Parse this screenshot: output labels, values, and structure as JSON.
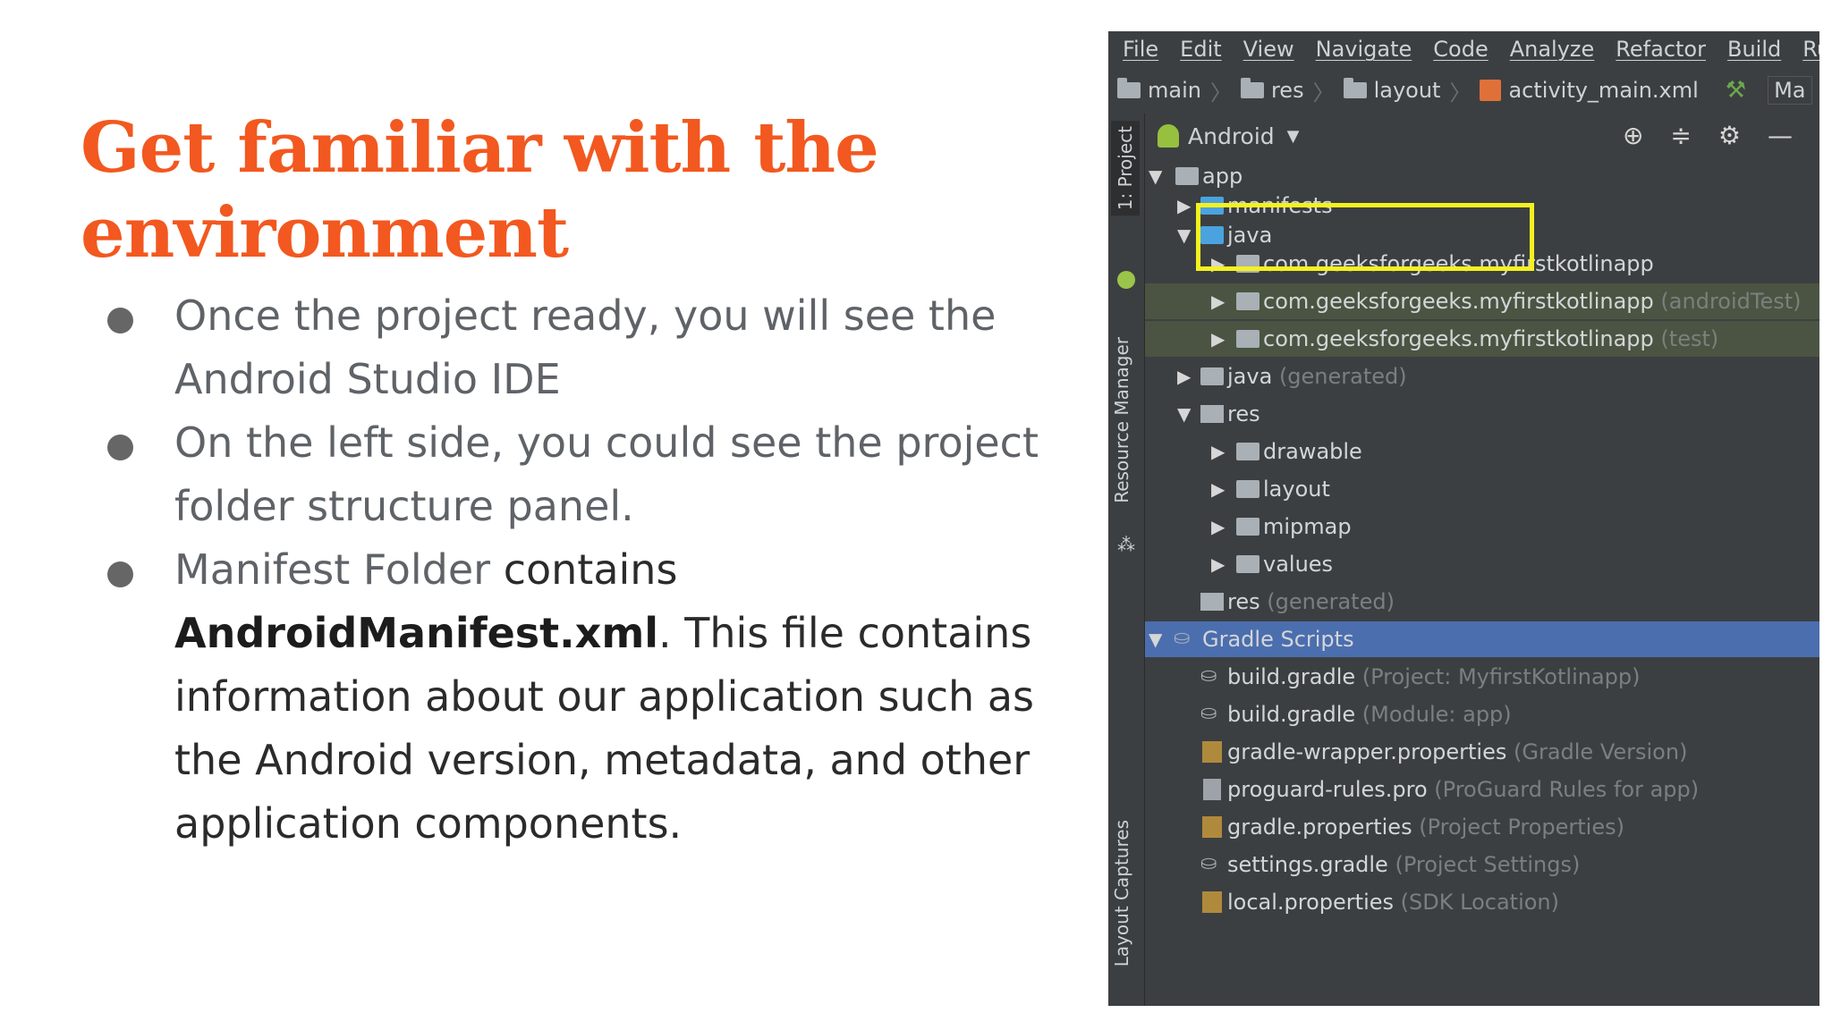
{
  "slide": {
    "title": "Get familiar with the environment",
    "bullets": [
      {
        "text": "Once the project ready, you will see the Android Studio IDE"
      },
      {
        "text": "On the left side, you could see the project folder structure panel."
      },
      {
        "text_a": "Manifest Folder",
        "text_b": " contains ",
        "strong": "AndroidManifest.xml",
        "text_c": ". This file contains information about our application such as the Android version, metadata, and other application components."
      }
    ],
    "colors": {
      "title": "#f2581f",
      "body": "#5f6368",
      "highlight_box": "#f4f120"
    }
  },
  "ide": {
    "menu": [
      "File",
      "Edit",
      "View",
      "Navigate",
      "Code",
      "Analyze",
      "Refactor",
      "Build",
      "Run"
    ],
    "breadcrumb": [
      "main",
      "res",
      "layout",
      "activity_main.xml"
    ],
    "run_config": "Ma",
    "side_tabs": {
      "project": "1: Project",
      "resource_manager": "Resource Manager",
      "layout_captures": "Layout Captures"
    },
    "panel": {
      "view_mode": "Android"
    },
    "tree": [
      {
        "label": "app",
        "hint": ""
      },
      {
        "label": "manifests",
        "hint": ""
      },
      {
        "label": "java",
        "hint": ""
      },
      {
        "label": "com.geeksforgeeks.myfirstkotlinapp",
        "hint": ""
      },
      {
        "label": "com.geeksforgeeks.myfirstkotlinapp",
        "hint": "(androidTest)"
      },
      {
        "label": "com.geeksforgeeks.myfirstkotlinapp",
        "hint": "(test)"
      },
      {
        "label": "java",
        "hint": "(generated)"
      },
      {
        "label": "res",
        "hint": ""
      },
      {
        "label": "drawable",
        "hint": ""
      },
      {
        "label": "layout",
        "hint": ""
      },
      {
        "label": "mipmap",
        "hint": ""
      },
      {
        "label": "values",
        "hint": ""
      },
      {
        "label": "res",
        "hint": "(generated)"
      },
      {
        "label": "Gradle Scripts",
        "hint": ""
      },
      {
        "label": "build.gradle",
        "hint": "(Project: MyfirstKotlinapp)"
      },
      {
        "label": "build.gradle",
        "hint": "(Module: app)"
      },
      {
        "label": "gradle-wrapper.properties",
        "hint": "(Gradle Version)"
      },
      {
        "label": "proguard-rules.pro",
        "hint": "(ProGuard Rules for app)"
      },
      {
        "label": "gradle.properties",
        "hint": "(Project Properties)"
      },
      {
        "label": "settings.gradle",
        "hint": "(Project Settings)"
      },
      {
        "label": "local.properties",
        "hint": "(SDK Location)"
      }
    ]
  }
}
